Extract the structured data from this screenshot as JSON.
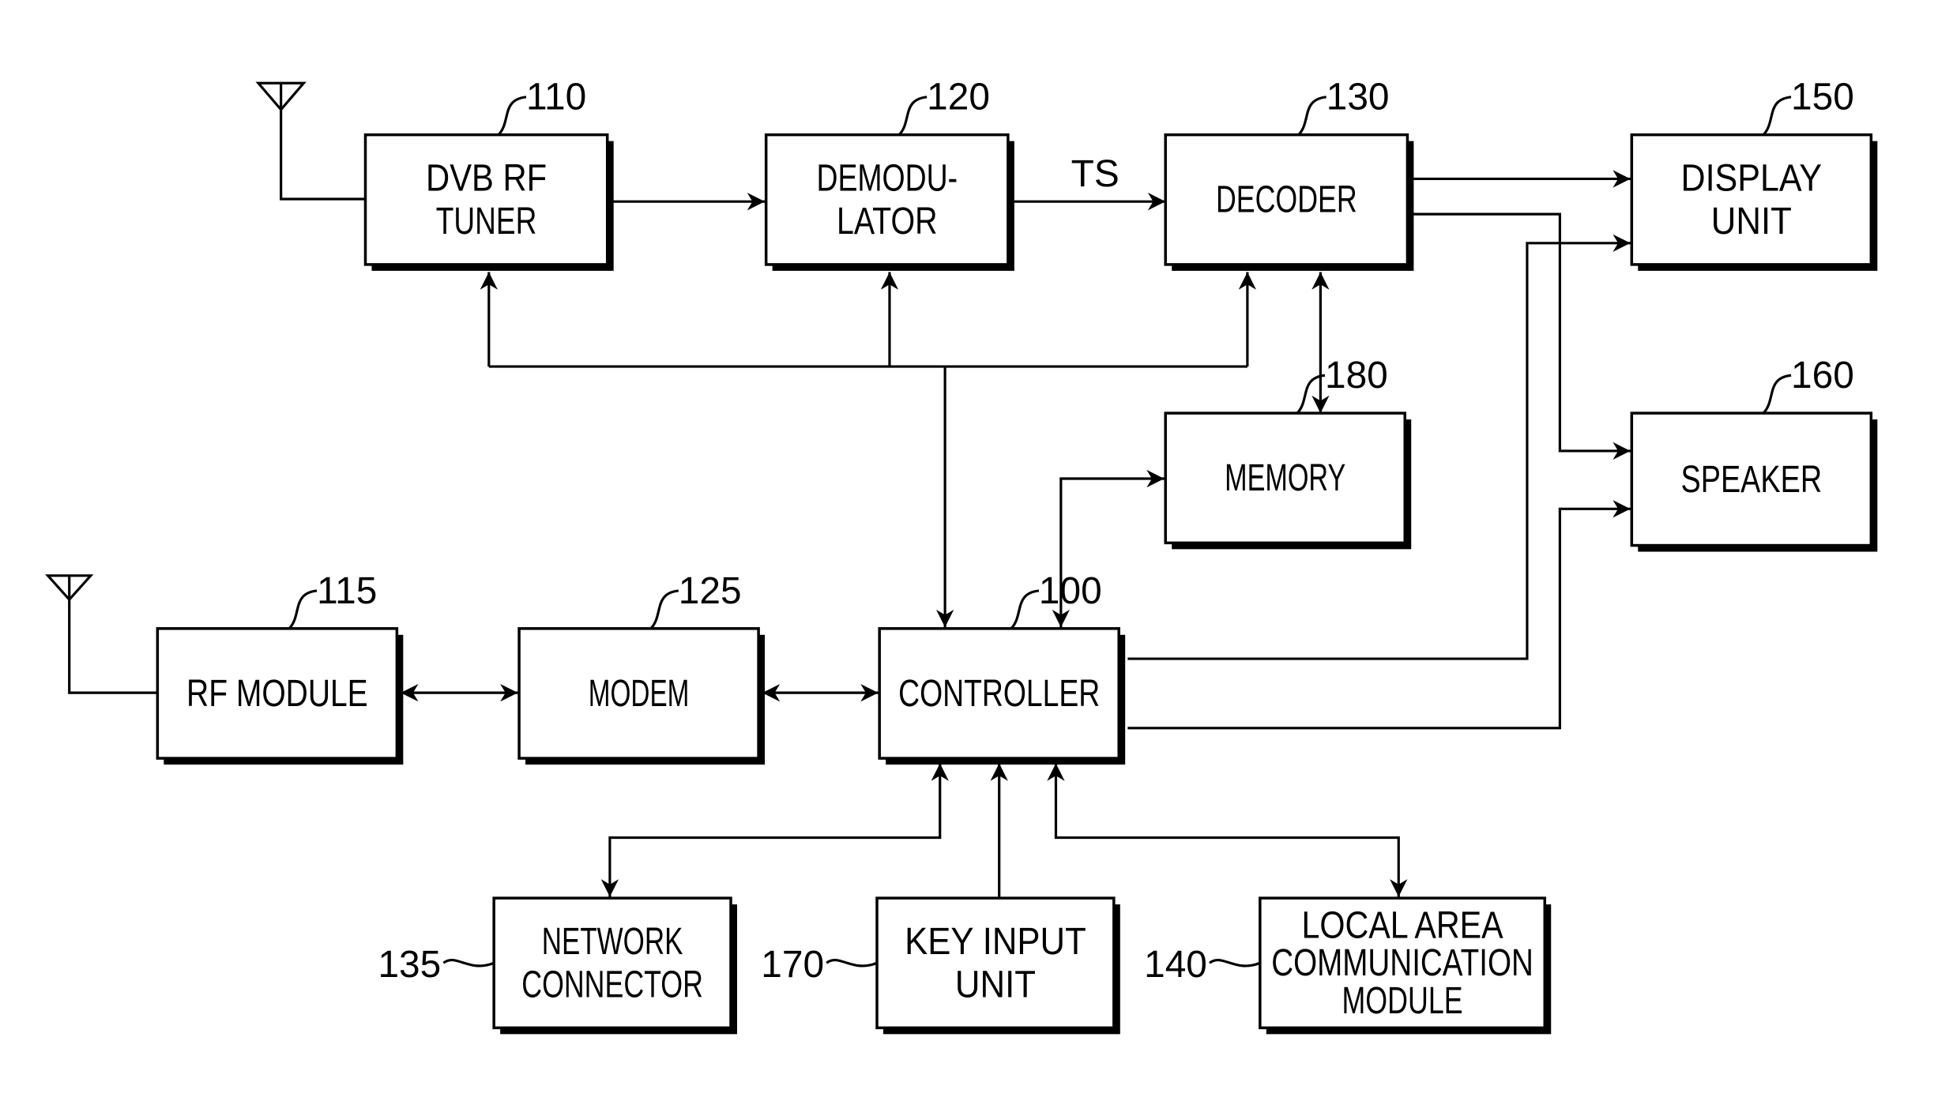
{
  "blocks": {
    "tuner": {
      "ref": "110",
      "lines": [
        "DVB RF",
        "TUNER"
      ]
    },
    "demod": {
      "ref": "120",
      "lines": [
        "DEMODU-",
        "LATOR"
      ]
    },
    "decoder": {
      "ref": "130",
      "lines": [
        "DECODER"
      ]
    },
    "display": {
      "ref": "150",
      "lines": [
        "DISPLAY",
        "UNIT"
      ]
    },
    "memory": {
      "ref": "180",
      "lines": [
        "MEMORY"
      ]
    },
    "speaker": {
      "ref": "160",
      "lines": [
        "SPEAKER"
      ]
    },
    "rf": {
      "ref": "115",
      "lines": [
        "RF MODULE"
      ]
    },
    "modem": {
      "ref": "125",
      "lines": [
        "MODEM"
      ]
    },
    "ctrl": {
      "ref": "100",
      "lines": [
        "CONTROLLER"
      ]
    },
    "net": {
      "ref": "135",
      "lines": [
        "NETWORK",
        "CONNECTOR"
      ]
    },
    "key": {
      "ref": "170",
      "lines": [
        "KEY INPUT",
        "UNIT"
      ]
    },
    "local": {
      "ref": "140",
      "lines": [
        "LOCAL AREA",
        "COMMUNICATION",
        "MODULE"
      ]
    }
  },
  "signals": {
    "ts": "TS"
  }
}
